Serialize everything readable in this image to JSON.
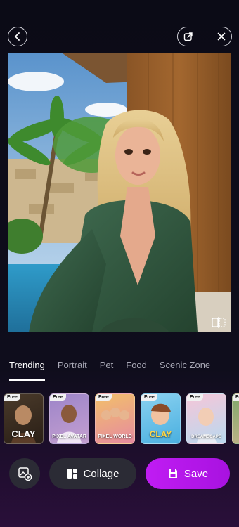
{
  "colors": {
    "accent": "#b517ea",
    "tab_active": "#ffffff",
    "tab_inactive": "#a9a9b6"
  },
  "header": {
    "back_icon": "chevron-left-icon",
    "share_icon": "share-icon",
    "close_icon": "close-icon"
  },
  "tabs": [
    {
      "label": "Trending",
      "active": true
    },
    {
      "label": "Portrait",
      "active": false
    },
    {
      "label": "Pet",
      "active": false
    },
    {
      "label": "Food",
      "active": false
    },
    {
      "label": "Scenic Zone",
      "active": false
    }
  ],
  "styles": [
    {
      "badge": "Free",
      "title": "CLAY"
    },
    {
      "badge": "Free",
      "title": "PIXEL AVATAR"
    },
    {
      "badge": "Free",
      "title": "PIXEL WORLD"
    },
    {
      "badge": "Free",
      "title": "CLAY"
    },
    {
      "badge": "Free",
      "title": "DREAMSCAPE"
    },
    {
      "badge": "Free",
      "title": ""
    }
  ],
  "actions": {
    "collage_label": "Collage",
    "save_label": "Save"
  }
}
